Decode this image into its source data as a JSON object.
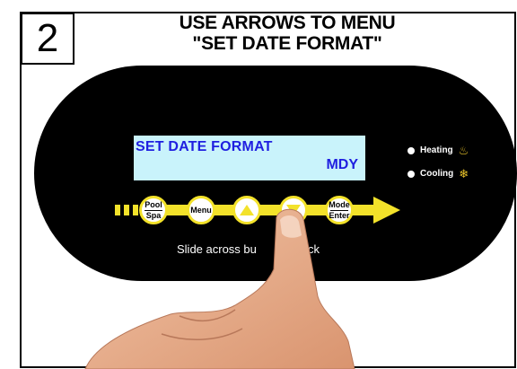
{
  "step": {
    "number": "2"
  },
  "header": {
    "line1": "USE ARROWS TO MENU",
    "line2": "\"SET DATE FORMAT\""
  },
  "lcd": {
    "line1": "SET DATE FORMAT",
    "line2": "MDY",
    "background": "#c9f3fb",
    "text_color": "#1f1fe0"
  },
  "indicators": [
    {
      "label": "Heating",
      "icon": "heating-icon"
    },
    {
      "label": "Cooling",
      "icon": "cooling-icon"
    }
  ],
  "buttons": {
    "pool_spa": {
      "top": "Pool",
      "bottom": "Spa"
    },
    "menu": {
      "label": "Menu"
    },
    "up": {
      "icon": "up-arrow-icon"
    },
    "down": {
      "icon": "down-arrow-icon"
    },
    "mode_enter": {
      "top": "Mode",
      "bottom": "Enter"
    }
  },
  "slide_hint": "Slide across bu      o unlock",
  "colors": {
    "panel": "#000000",
    "accent_yellow": "#f3e22a"
  }
}
